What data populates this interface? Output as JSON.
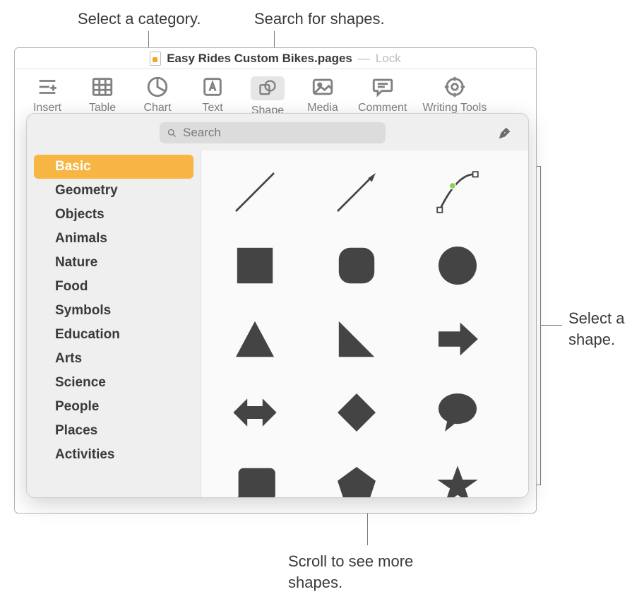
{
  "annotations": {
    "category": "Select a category.",
    "search": "Search for shapes.",
    "select_shape": "Select a shape.",
    "scroll": "Scroll to see more shapes."
  },
  "titlebar": {
    "filename": "Easy Rides Custom Bikes.pages",
    "lock_label": "Lock"
  },
  "toolbar": {
    "insert": "Insert",
    "table": "Table",
    "chart": "Chart",
    "text": "Text",
    "shape": "Shape",
    "media": "Media",
    "comment": "Comment",
    "writing_tools": "Writing Tools"
  },
  "popover": {
    "search_placeholder": "Search",
    "categories": [
      "Basic",
      "Geometry",
      "Objects",
      "Animals",
      "Nature",
      "Food",
      "Symbols",
      "Education",
      "Arts",
      "Science",
      "People",
      "Places",
      "Activities"
    ],
    "selected_category_index": 0,
    "shapes": [
      "line",
      "arrow-line",
      "curve",
      "square",
      "rounded-square",
      "circle",
      "triangle",
      "right-triangle",
      "arrow-right",
      "double-arrow",
      "diamond",
      "speech-bubble",
      "callout-square",
      "pentagon",
      "star"
    ]
  }
}
